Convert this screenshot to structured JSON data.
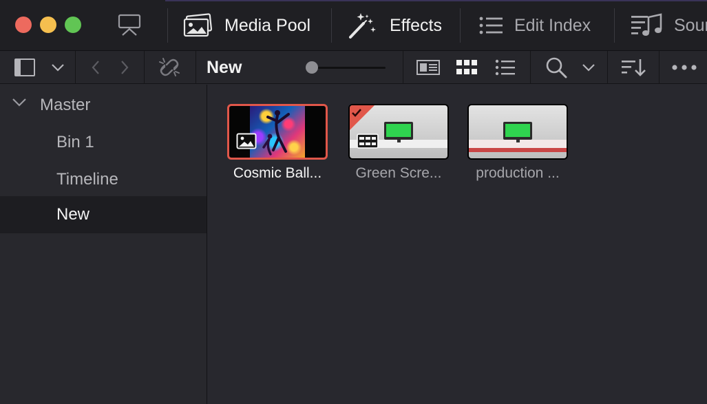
{
  "toolbar": {
    "media_pool_label": "Media Pool",
    "effects_label": "Effects",
    "edit_index_label": "Edit Index",
    "sound_label": "Sour"
  },
  "bin_bar": {
    "current_bin": "New"
  },
  "sidebar": {
    "root": "Master",
    "items": [
      {
        "label": "Bin 1"
      },
      {
        "label": "Timeline"
      },
      {
        "label": "New"
      }
    ]
  },
  "clips": [
    {
      "name": "Cosmic Ball..."
    },
    {
      "name": "Green Scre..."
    },
    {
      "name": "production ..."
    }
  ],
  "colors": {
    "selection_border": "#e1574a",
    "selected_badge": "#e1574a",
    "green_screen": "#2fd44f"
  }
}
